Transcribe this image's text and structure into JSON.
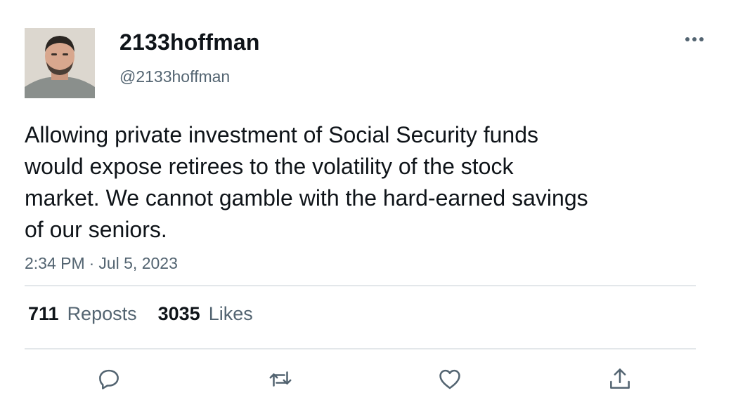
{
  "author": {
    "display_name": "2133hoffman",
    "handle": "@2133hoffman"
  },
  "tweet": {
    "text_lines": [
      "Allowing private investment of Social Security funds",
      "would expose retirees to the volatility of the stock",
      "market. We cannot gamble with the hard-earned savings",
      "of our seniors."
    ],
    "time": "2:34 PM",
    "separator": "·",
    "date": "Jul 5, 2023"
  },
  "stats": {
    "reposts_count": "711",
    "reposts_label": "Reposts",
    "likes_count": "3035",
    "likes_label": "Likes"
  },
  "icons": {
    "more": "more-horizontal-icon",
    "reply": "reply-icon",
    "repost": "repost-icon",
    "like": "like-icon",
    "share": "share-icon"
  },
  "colors": {
    "text": "#0f1419",
    "secondary": "#536471",
    "divider": "#e3e7ea"
  }
}
